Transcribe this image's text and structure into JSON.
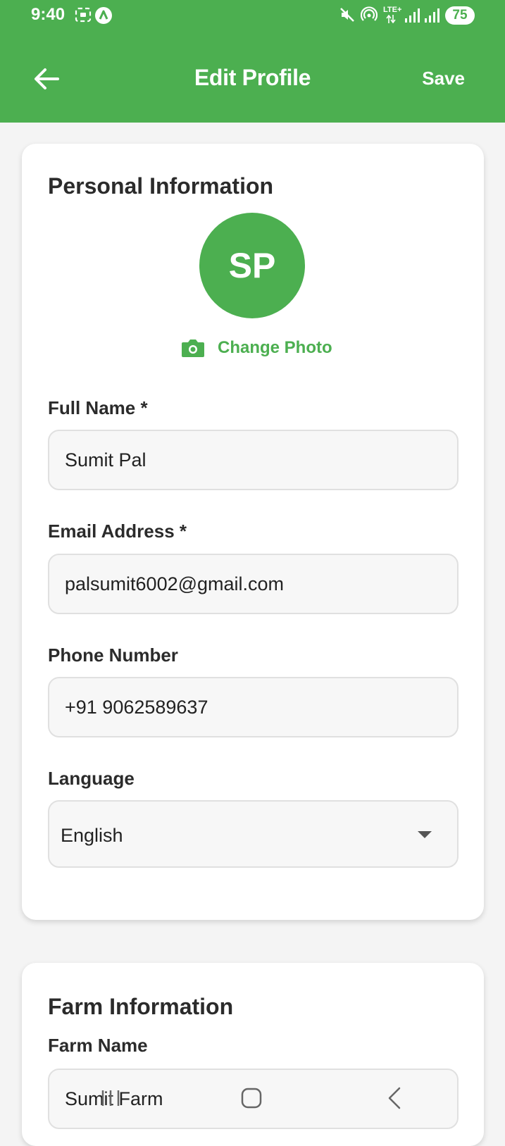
{
  "status_bar": {
    "time": "9:40",
    "network_label": "LTE+",
    "battery": "75"
  },
  "header": {
    "title": "Edit Profile",
    "save_label": "Save",
    "background_color": "#4caf50"
  },
  "personal_section": {
    "title": "Personal Information",
    "avatar_initials": "SP",
    "change_photo_label": "Change Photo",
    "fields": {
      "full_name": {
        "label": "Full Name *",
        "value": "Sumit Pal"
      },
      "email": {
        "label": "Email Address *",
        "value": "palsumit6002@gmail.com"
      },
      "phone": {
        "label": "Phone Number",
        "value": "+91 9062589637"
      },
      "language": {
        "label": "Language",
        "value": "English"
      }
    }
  },
  "farm_section": {
    "title": "Farm Information",
    "fields": {
      "farm_name": {
        "label": "Farm Name",
        "value": "Sumit Farm"
      }
    }
  },
  "icons": {
    "back": "arrow-left-icon",
    "camera": "camera-icon",
    "dropdown": "triangle-down-icon",
    "nav_recents": "recents-icon",
    "nav_home": "home-icon",
    "nav_back": "chevron-left-icon"
  }
}
